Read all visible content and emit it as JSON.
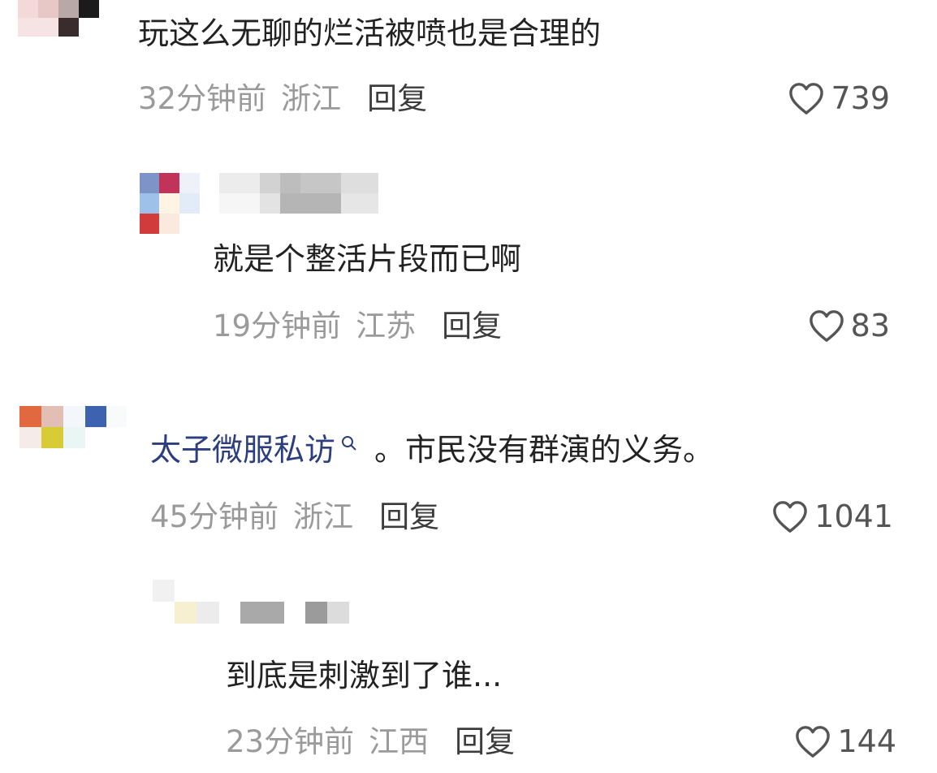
{
  "comments": [
    {
      "text": "玩这么无聊的烂活被喷也是合理的",
      "time": "32分钟前",
      "location": "浙江",
      "reply_label": "回复",
      "likes": "739",
      "avatar_colors": [
        "#f3d9d9",
        "#e8c7c7",
        "#b8a8a8",
        "#1b1b1b",
        "#f6e3e3",
        "#3a2c2c"
      ]
    },
    {
      "text": "就是个整活片段而已啊",
      "time": "19分钟前",
      "location": "江苏",
      "reply_label": "回复",
      "likes": "83",
      "avatar_colors": [
        "#7e93c8",
        "#c2335a",
        "#eef2f8",
        "#9ec1ea",
        "#fff3e4",
        "#e2ecf8",
        "#d23b3b",
        "#fbe9de",
        "#ffffff"
      ]
    },
    {
      "author": "太子微服私访",
      "text": "。市民没有群演的义务。",
      "time": "45分钟前",
      "location": "浙江",
      "reply_label": "回复",
      "likes": "1041",
      "avatar_colors": [
        "#e1683f",
        "#e2bfb5",
        "#f3f7fb",
        "#3d62b0",
        "#f5ecea",
        "#d8cc36",
        "#eaf6f3",
        "#f8fafc"
      ]
    },
    {
      "text": "到底是刺激到了谁...",
      "time": "23分钟前",
      "location": "江西",
      "reply_label": "回复",
      "likes": "144",
      "avatar_colors": [
        "#f1f1f1",
        "#f7f0d0",
        "#ececec",
        "#f7f7f7"
      ]
    }
  ],
  "colors": {
    "text": "#222222",
    "meta": "#9a9a9a",
    "author_link": "#2c3e7e",
    "background": "#ffffff"
  }
}
